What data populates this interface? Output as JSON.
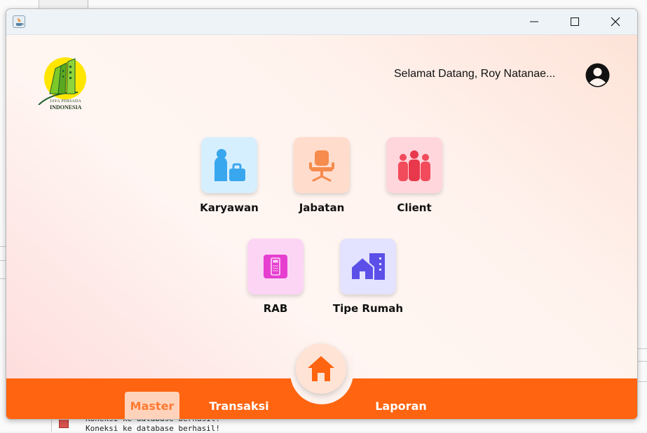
{
  "background": {
    "console_lines": [
      "Koneksi ke database berhasil!",
      "Koneksi ke database berhasil!"
    ]
  },
  "window": {
    "title": "",
    "controls": {
      "minimize": "minimize-icon",
      "maximize": "maximize-icon",
      "close": "close-icon"
    }
  },
  "header": {
    "logo_line1": "JAYA PERSADA",
    "logo_line2": "INDONESIA",
    "greeting": "Selamat Datang,",
    "user_name": "Roy Natanae..."
  },
  "menu": {
    "tiles": [
      {
        "label": "Karyawan",
        "icon": "employee-icon",
        "color": "#d6efff"
      },
      {
        "label": "Jabatan",
        "icon": "office-chair-icon",
        "color": "#ffdccc"
      },
      {
        "label": "Client",
        "icon": "client-group-icon",
        "color": "#ffd6dc"
      },
      {
        "label": "RAB",
        "icon": "calculator-icon",
        "color": "#fcd5f5"
      },
      {
        "label": "Tipe Rumah",
        "icon": "house-building-icon",
        "color": "#e3e2ff"
      }
    ]
  },
  "bottom_nav": {
    "items": [
      {
        "label": "Master",
        "active": true
      },
      {
        "label": "Transaksi",
        "active": false
      },
      {
        "label": "Laporan",
        "active": false
      }
    ],
    "home_icon": "home-icon"
  },
  "colors": {
    "accent": "#ff6410",
    "home": "#ff6410"
  }
}
